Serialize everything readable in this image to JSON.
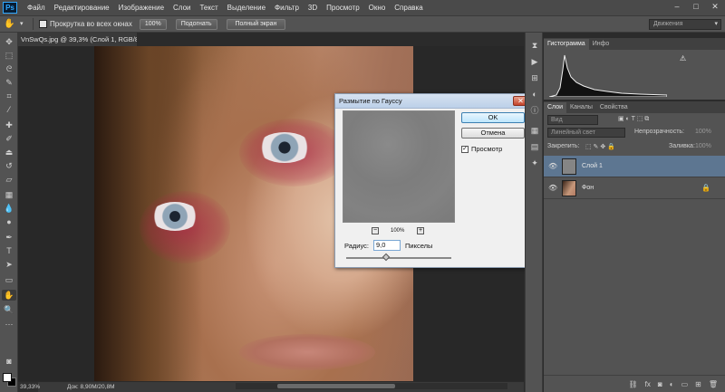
{
  "app": {
    "logo": "Ps"
  },
  "menu": [
    "Файл",
    "Редактирование",
    "Изображение",
    "Слои",
    "Текст",
    "Выделение",
    "Фильтр",
    "3D",
    "Просмотр",
    "Окно",
    "Справка"
  ],
  "window_controls": {
    "minimize": "–",
    "maximize": "□",
    "close": "✕"
  },
  "options_bar": {
    "scroll_all_label": "Прокрутка во всех окнах",
    "zoom_100": "100%",
    "fit": "Подогнать",
    "fullscreen": "Полный экран",
    "workspace": "Движения"
  },
  "document": {
    "tab_title": "VnSwQs.jpg @ 39,3% (Слой 1, RGB/8#) *",
    "tab_close": "✕",
    "status_zoom": "39,33%",
    "status_doc": "Док: 8,90M/20,8M"
  },
  "dialog": {
    "title": "Размытие по Гауссу",
    "close": "✕",
    "ok": "OK",
    "cancel": "Отмена",
    "preview_label": "Просмотр",
    "preview_checked": "✓",
    "zoom_out": "−",
    "zoom_in": "+",
    "zoom_value": "100%",
    "radius_label": "Радиус:",
    "radius_value": "9,0",
    "radius_unit": "Пикселы",
    "radius_slider_fraction": 0.38
  },
  "histogram_panel": {
    "tabs": [
      "Гистограмма",
      "Инфо"
    ],
    "warning": "⚠"
  },
  "layers_panel": {
    "tabs": [
      "Слои",
      "Каналы",
      "Свойства"
    ],
    "kind_filter": "Вид",
    "blend_mode": "Линейный свет",
    "opacity_label": "Непрозрачность:",
    "opacity_value": "100%",
    "lock_label": "Закрепить:",
    "fill_label": "Заливка:",
    "fill_value": "100%",
    "layers": [
      {
        "name": "Слой 1",
        "selected": true
      },
      {
        "name": "Фон",
        "selected": false
      }
    ]
  },
  "colors": {
    "selected_layer": "#5d7691",
    "ok_button": "#bee6fd"
  }
}
